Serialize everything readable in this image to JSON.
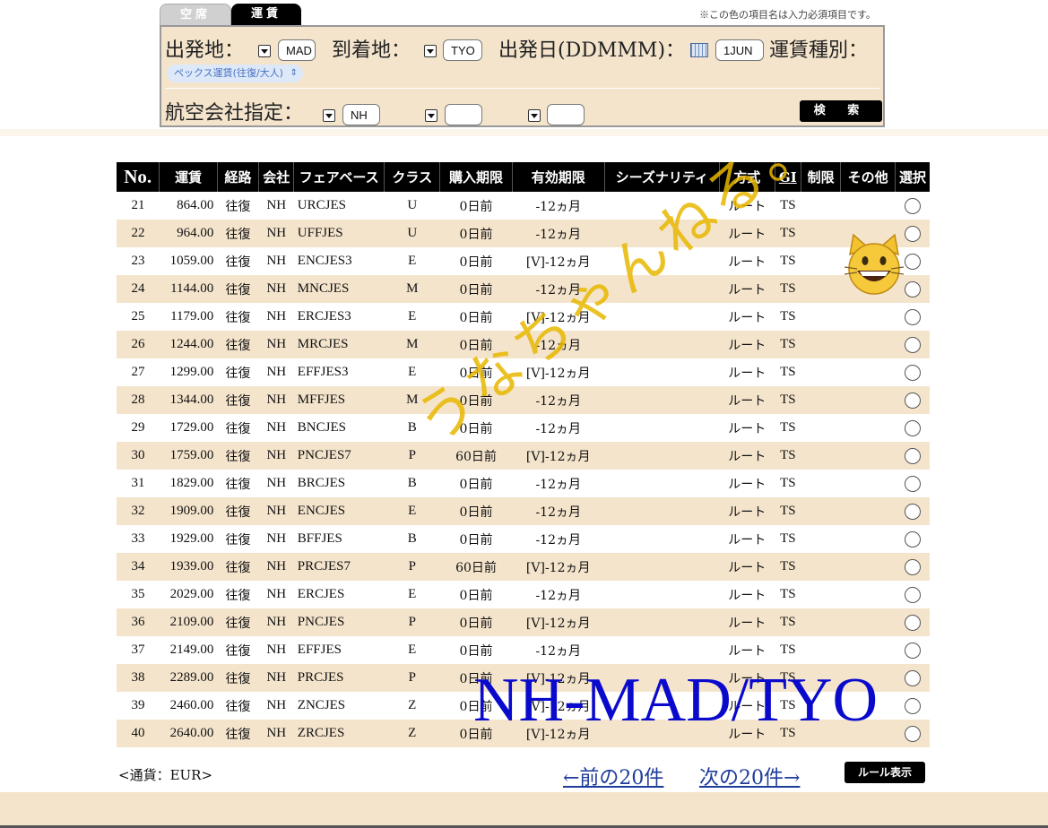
{
  "tabs": {
    "vacancy": "空席",
    "fare": "運賃"
  },
  "required_note": "※この色の項目名は入力必須項目です。",
  "search": {
    "origin_label": "出発地：",
    "origin_value": "MAD",
    "destination_label": "到着地：",
    "destination_value": "TYO",
    "date_label": "出発日(DDMMM)：",
    "date_value": "1JUN",
    "fare_type_label": "運賃種別：",
    "fare_type_value": "ペックス運賃(往復/大人)",
    "airline_label": "航空会社指定：",
    "airline_values": [
      "NH",
      "",
      ""
    ],
    "search_button": "検 索"
  },
  "table": {
    "headers": [
      "No.",
      "運賃",
      "経路",
      "会社",
      "フェアベース",
      "クラス",
      "購入期限",
      "有効期限",
      "シーズナリティ",
      "方式",
      "GI",
      "制限",
      "その他",
      "選択"
    ],
    "rows": [
      [
        "21",
        "864.00",
        "往復",
        "NH",
        "URCJES",
        "U",
        "0日前",
        "-12ヵ月",
        "",
        "ルート",
        "TS",
        "",
        ""
      ],
      [
        "22",
        "964.00",
        "往復",
        "NH",
        "UFFJES",
        "U",
        "0日前",
        "-12ヵ月",
        "",
        "ルート",
        "TS",
        "",
        ""
      ],
      [
        "23",
        "1059.00",
        "往復",
        "NH",
        "ENCJES3",
        "E",
        "0日前",
        "[V]-12ヵ月",
        "",
        "ルート",
        "TS",
        "",
        ""
      ],
      [
        "24",
        "1144.00",
        "往復",
        "NH",
        "MNCJES",
        "M",
        "0日前",
        "-12ヵ月",
        "",
        "ルート",
        "TS",
        "",
        ""
      ],
      [
        "25",
        "1179.00",
        "往復",
        "NH",
        "ERCJES3",
        "E",
        "0日前",
        "[V]-12ヵ月",
        "",
        "ルート",
        "TS",
        "",
        ""
      ],
      [
        "26",
        "1244.00",
        "往復",
        "NH",
        "MRCJES",
        "M",
        "0日前",
        "-12ヵ月",
        "",
        "ルート",
        "TS",
        "",
        ""
      ],
      [
        "27",
        "1299.00",
        "往復",
        "NH",
        "EFFJES3",
        "E",
        "0日前",
        "[V]-12ヵ月",
        "",
        "ルート",
        "TS",
        "",
        ""
      ],
      [
        "28",
        "1344.00",
        "往復",
        "NH",
        "MFFJES",
        "M",
        "0日前",
        "-12ヵ月",
        "",
        "ルート",
        "TS",
        "",
        ""
      ],
      [
        "29",
        "1729.00",
        "往復",
        "NH",
        "BNCJES",
        "B",
        "0日前",
        "-12ヵ月",
        "",
        "ルート",
        "TS",
        "",
        ""
      ],
      [
        "30",
        "1759.00",
        "往復",
        "NH",
        "PNCJES7",
        "P",
        "60日前",
        "[V]-12ヵ月",
        "",
        "ルート",
        "TS",
        "",
        ""
      ],
      [
        "31",
        "1829.00",
        "往復",
        "NH",
        "BRCJES",
        "B",
        "0日前",
        "-12ヵ月",
        "",
        "ルート",
        "TS",
        "",
        ""
      ],
      [
        "32",
        "1909.00",
        "往復",
        "NH",
        "ENCJES",
        "E",
        "0日前",
        "-12ヵ月",
        "",
        "ルート",
        "TS",
        "",
        ""
      ],
      [
        "33",
        "1929.00",
        "往復",
        "NH",
        "BFFJES",
        "B",
        "0日前",
        "-12ヵ月",
        "",
        "ルート",
        "TS",
        "",
        ""
      ],
      [
        "34",
        "1939.00",
        "往復",
        "NH",
        "PRCJES7",
        "P",
        "60日前",
        "[V]-12ヵ月",
        "",
        "ルート",
        "TS",
        "",
        ""
      ],
      [
        "35",
        "2029.00",
        "往復",
        "NH",
        "ERCJES",
        "E",
        "0日前",
        "-12ヵ月",
        "",
        "ルート",
        "TS",
        "",
        ""
      ],
      [
        "36",
        "2109.00",
        "往復",
        "NH",
        "PNCJES",
        "P",
        "0日前",
        "[V]-12ヵ月",
        "",
        "ルート",
        "TS",
        "",
        ""
      ],
      [
        "37",
        "2149.00",
        "往復",
        "NH",
        "EFFJES",
        "E",
        "0日前",
        "-12ヵ月",
        "",
        "ルート",
        "TS",
        "",
        ""
      ],
      [
        "38",
        "2289.00",
        "往復",
        "NH",
        "PRCJES",
        "P",
        "0日前",
        "[V]-12ヵ月",
        "",
        "ルート",
        "TS",
        "",
        ""
      ],
      [
        "39",
        "2460.00",
        "往復",
        "NH",
        "ZNCJES",
        "Z",
        "0日前",
        "[V]-12ヵ月",
        "",
        "ルート",
        "TS",
        "",
        ""
      ],
      [
        "40",
        "2640.00",
        "往復",
        "NH",
        "ZRCJES",
        "Z",
        "0日前",
        "[V]-12ヵ月",
        "",
        "ルート",
        "TS",
        "",
        ""
      ]
    ]
  },
  "footer": {
    "currency": "<通貨：EUR>",
    "prev": "←前の20件",
    "next": "次の20件→",
    "rules_button": "ルール表示"
  },
  "overlays": {
    "handwriting": "うなちゃんねる。",
    "title": "NH-MAD/TYO",
    "sticker_icon": "grinning-cat-icon"
  },
  "colors": {
    "panel_bg": "#f4e4cc",
    "header_bg": "#000000",
    "link": "#1e3c9a",
    "overlay_title": "#0a0acc",
    "handwriting": "#e8b800"
  }
}
